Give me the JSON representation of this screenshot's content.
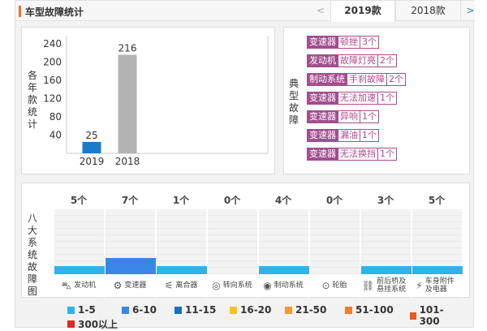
{
  "header": {
    "title": "车型故障统计"
  },
  "tabs": {
    "prev": "<",
    "next": ">",
    "items": [
      "2019款",
      "2018款"
    ],
    "active": 0
  },
  "chart_data": {
    "type": "bar",
    "categories": [
      "2019",
      "2018"
    ],
    "values": [
      25,
      216
    ],
    "bar_colors": [
      "#1a7bc9",
      "#b3b3b3"
    ],
    "ylabel": "各年款统计",
    "yticks": [
      40,
      80,
      120,
      160,
      200,
      240
    ],
    "ylim": [
      0,
      240
    ],
    "grid": false
  },
  "typical": {
    "label": "典型故障",
    "items": [
      {
        "system": "变速器",
        "issue": "顿挫",
        "count": "3个"
      },
      {
        "system": "发动机",
        "issue": "故障灯亮",
        "count": "2个"
      },
      {
        "system": "制动系统",
        "issue": "手刹故障",
        "count": "2个"
      },
      {
        "system": "变速器",
        "issue": "无法加速",
        "count": "1个"
      },
      {
        "system": "变速器",
        "issue": "异响",
        "count": "1个"
      },
      {
        "system": "变速器",
        "issue": "漏油",
        "count": "1个"
      },
      {
        "system": "变速器",
        "issue": "无法换挡",
        "count": "1个"
      }
    ]
  },
  "matrix": {
    "label": "八大系统故障图",
    "systems": [
      {
        "count": "5个",
        "value": 5,
        "name": "发动机",
        "icon": "engine-icon",
        "glyph": "⛍"
      },
      {
        "count": "7个",
        "value": 7,
        "name": "变速器",
        "icon": "gearbox-icon",
        "glyph": "⚙"
      },
      {
        "count": "1个",
        "value": 1,
        "name": "离合器",
        "icon": "clutch-icon",
        "glyph": "⚟"
      },
      {
        "count": "0个",
        "value": 0,
        "name": "转向系统",
        "icon": "steering-icon",
        "glyph": "◎"
      },
      {
        "count": "4个",
        "value": 4,
        "name": "制动系统",
        "icon": "brake-icon",
        "glyph": "◉"
      },
      {
        "count": "0个",
        "value": 0,
        "name": "轮胎",
        "icon": "tire-icon",
        "glyph": "⊙"
      },
      {
        "count": "3个",
        "value": 3,
        "name": "前后桥及悬挂系统",
        "icon": "suspension-icon",
        "glyph": "⛓"
      },
      {
        "count": "5个",
        "value": 5,
        "name": "车身附件及电器",
        "icon": "electrical-icon",
        "glyph": "⚡"
      }
    ]
  },
  "legend": [
    {
      "label": "1-5",
      "color": "#2fb3f0"
    },
    {
      "label": "6-10",
      "color": "#3a86e8"
    },
    {
      "label": "11-15",
      "color": "#1a6fba"
    },
    {
      "label": "16-20",
      "color": "#f5c41c"
    },
    {
      "label": "21-50",
      "color": "#f19a2d"
    },
    {
      "label": "51-100",
      "color": "#f07d2a"
    },
    {
      "label": "101-300",
      "color": "#e9581f"
    },
    {
      "label": "300以上",
      "color": "#e42828"
    }
  ]
}
